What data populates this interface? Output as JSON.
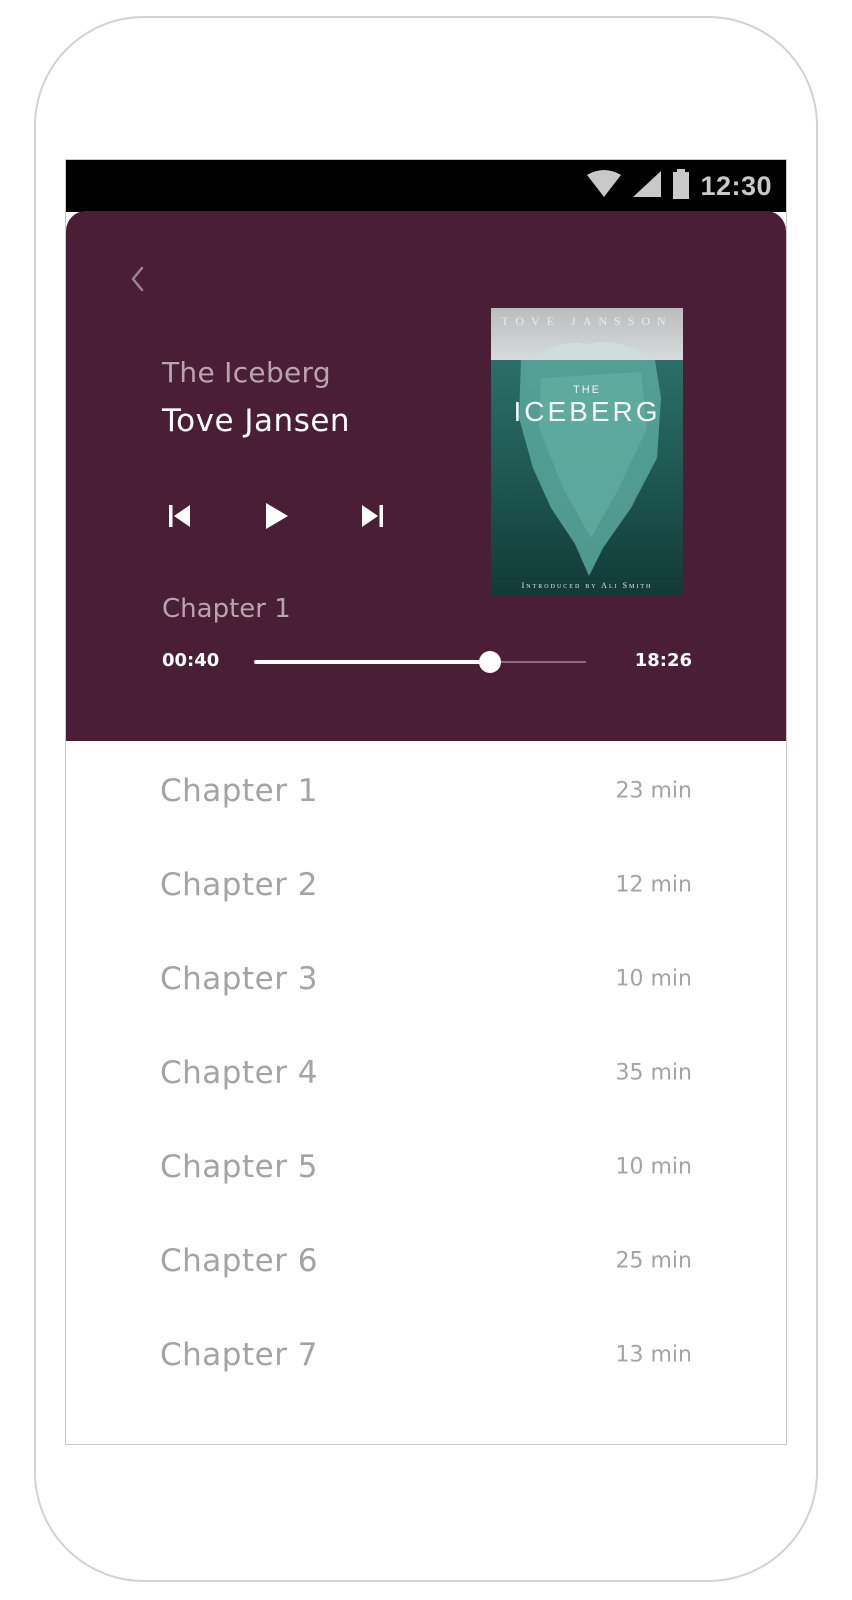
{
  "status_bar": {
    "time": "12:30",
    "icons": [
      "wifi-icon",
      "signal-icon",
      "battery-icon"
    ]
  },
  "player": {
    "book_title": "The Iceberg",
    "author": "Tove Jansen",
    "current_chapter": "Chapter 1",
    "time_elapsed": "00:40",
    "time_total": "18:26",
    "progress_fraction": 0.71,
    "controls": [
      "skip-previous-icon",
      "play-icon",
      "skip-next-icon"
    ]
  },
  "cover": {
    "author": "TOVE JANSSON",
    "the": "THE",
    "title": "ICEBERG",
    "intro": "Introduced by Ali Smith"
  },
  "chapters": [
    {
      "name": "Chapter 1",
      "duration": "23 min"
    },
    {
      "name": "Chapter 2",
      "duration": "12 min"
    },
    {
      "name": "Chapter 3",
      "duration": "10 min"
    },
    {
      "name": "Chapter 4",
      "duration": "35 min"
    },
    {
      "name": "Chapter 5",
      "duration": "10 min"
    },
    {
      "name": "Chapter 6",
      "duration": "25 min"
    },
    {
      "name": "Chapter 7",
      "duration": "13 min"
    }
  ],
  "colors": {
    "header_bg": "#4a1f35",
    "status_bar_bg": "#000000",
    "muted_text": "#a4a4a4",
    "cover_teal": "#3e8c80"
  }
}
